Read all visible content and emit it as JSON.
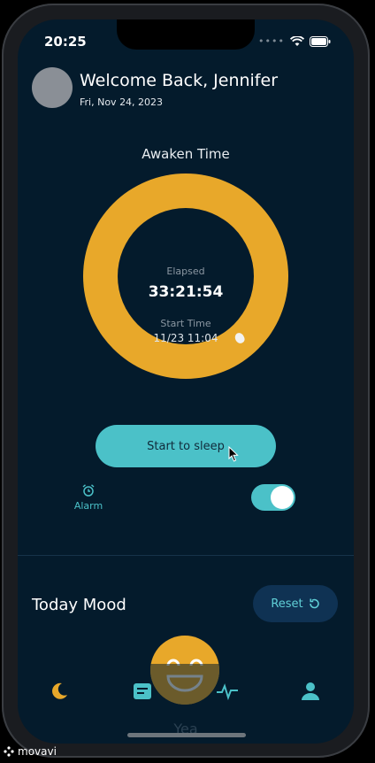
{
  "status_bar": {
    "time": "20:25",
    "signal_icon": "signal-dots-icon",
    "wifi_icon": "wifi-icon",
    "battery_icon": "battery-icon"
  },
  "header": {
    "greeting": "Welcome Back, Jennifer",
    "date": "Fri, Nov 24, 2023"
  },
  "awaken": {
    "title": "Awaken Time",
    "elapsed_label": "Elapsed",
    "elapsed_value": "33:21:54",
    "start_label": "Start Time",
    "start_value": "11/23 11:04",
    "ring_color": "#e8a82a"
  },
  "sleep_button": {
    "label": "Start to sleep",
    "color": "#4bc1c8"
  },
  "alarm": {
    "label": "Alarm",
    "icon": "alarm-clock-icon",
    "enabled": true
  },
  "mood": {
    "title": "Today Mood",
    "reset_label": "Reset",
    "reset_icon": "reset-icon",
    "current_label": "Yea"
  },
  "tabs": [
    {
      "name": "sleep",
      "icon": "moon-icon",
      "active": true
    },
    {
      "name": "journal",
      "icon": "journal-icon",
      "active": false
    },
    {
      "name": "stats",
      "icon": "pulse-icon",
      "active": false
    },
    {
      "name": "profile",
      "icon": "person-icon",
      "active": false
    }
  ],
  "watermark": {
    "text": "movavi"
  },
  "colors": {
    "background": "#041b2c",
    "accent": "#4bc1c8",
    "ring": "#e8a82a"
  }
}
